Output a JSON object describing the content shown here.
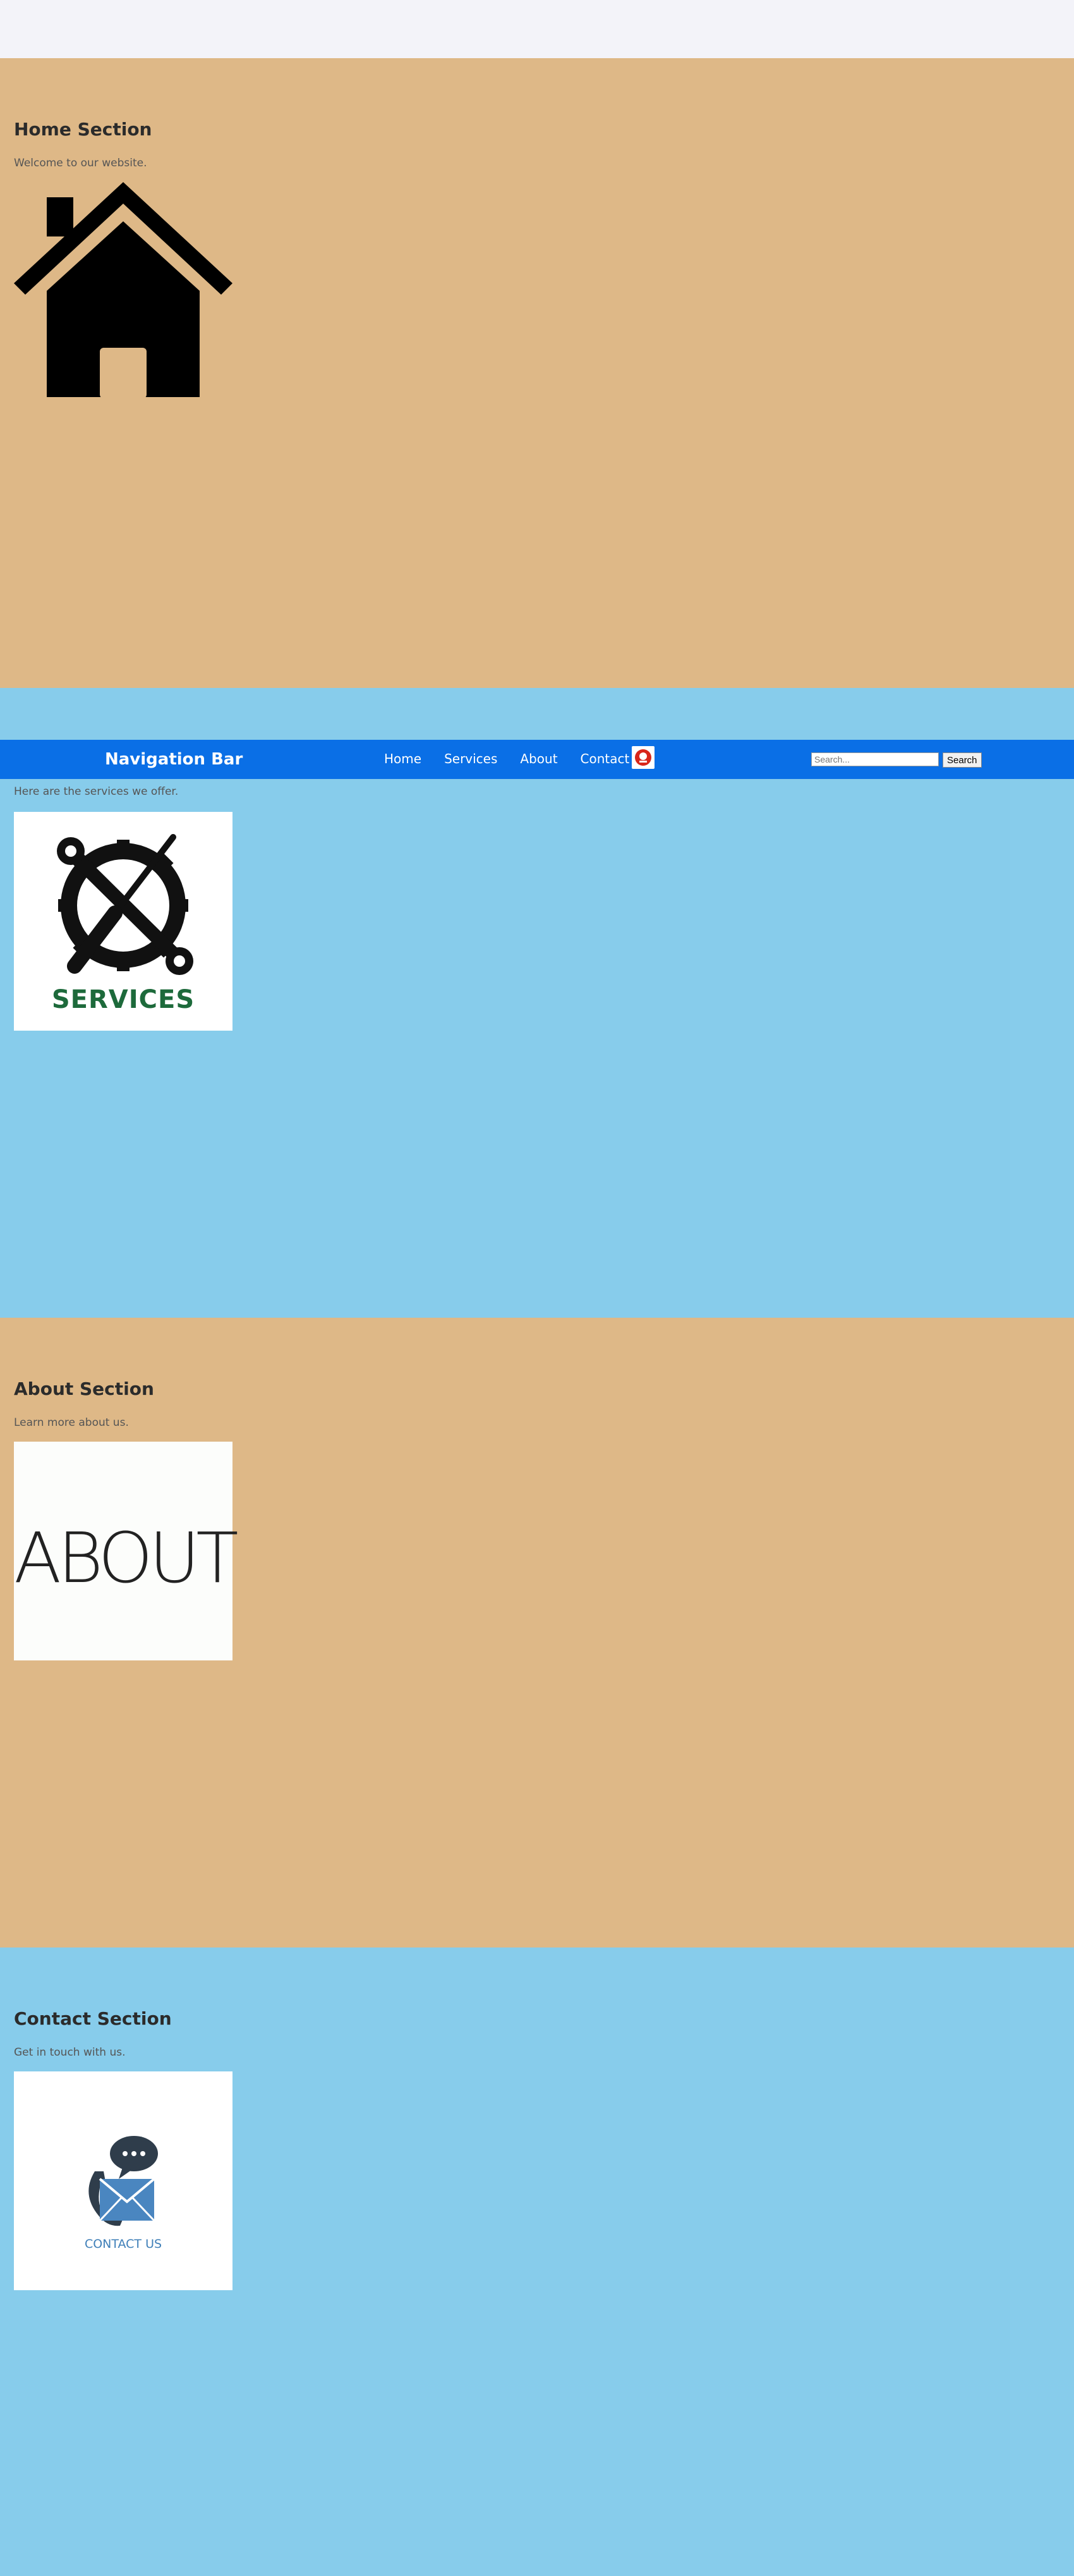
{
  "sections": {
    "home": {
      "title": "Home Section",
      "text": "Welcome to our website."
    },
    "services": {
      "text": "Here are the services we offer.",
      "image_caption": "SERVICES"
    },
    "about": {
      "title": "About Section",
      "text": "Learn more about us.",
      "image_caption": "ABOUT"
    },
    "contact": {
      "title": "Contact Section",
      "text": "Get in touch with us.",
      "image_caption": "CONTACT US"
    }
  },
  "navbar": {
    "brand": "Navigation Bar",
    "links": [
      "Home",
      "Services",
      "About",
      "Contact"
    ],
    "search_placeholder": "Search...",
    "search_button": "Search"
  },
  "colors": {
    "tan": "#deb887",
    "sky": "#87cceb",
    "nav_blue": "#0a6fe6"
  },
  "icons": {
    "home_image": "house-icon",
    "services_image": "wrench-screwdriver-gear-icon",
    "about_image": "about-text-image",
    "contact_image": "phone-mail-chat-icon",
    "nav_icon": "red-circle-icon"
  }
}
